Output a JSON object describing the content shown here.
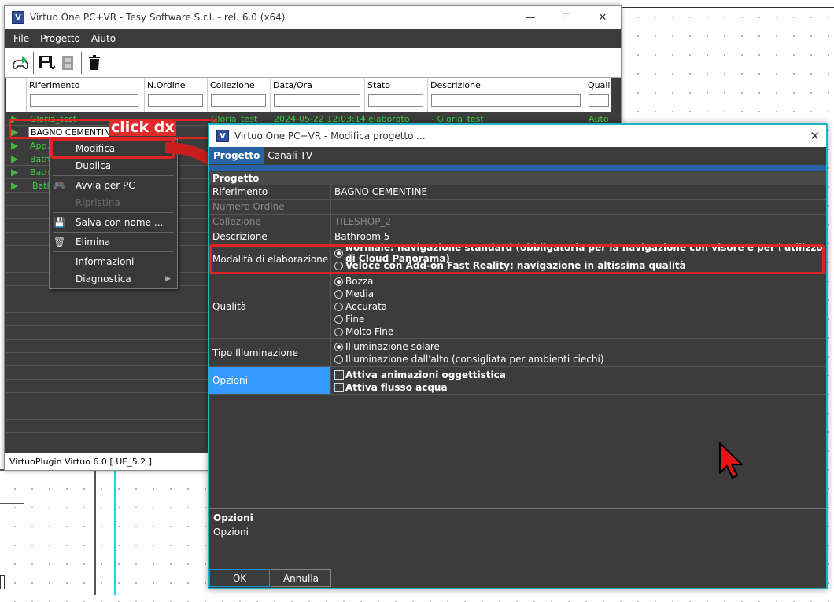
{
  "main_window": {
    "title": "Virtuo One PC+VR - Tesy Software S.r.l. - rel. 6.0  (x64)",
    "app_icon": "V",
    "controls": {
      "minimize": "—",
      "maximize": "☐",
      "close": "✕"
    },
    "menu": [
      "File",
      "Progetto",
      "Aiuto"
    ],
    "toolbar_icons": [
      "vr-gamepad-icon",
      "save-icon",
      "film-icon",
      "trash-icon"
    ],
    "columns": [
      "Riferimento",
      "N.Ordine",
      "Collezione",
      "Data/Ora",
      "Stato",
      "Descrizione",
      "Quali"
    ],
    "rows": [
      {
        "ref": "Gloria_test",
        "coll": "Gloria_test",
        "date": "2024-05-22 12:03:14",
        "stato": "elaborato",
        "desc": "- Gloria_test",
        "qual": "Auto"
      },
      {
        "ref": "BAGNO CEMENTINE",
        "coll": "",
        "date": "",
        "stato": "",
        "desc": "",
        "qual": ""
      },
      {
        "ref": "App..",
        "coll": "",
        "date": "",
        "stato": "",
        "desc": "",
        "qual": ""
      },
      {
        "ref": "Bathr",
        "coll": "",
        "date": "",
        "stato": "",
        "desc": "",
        "qual": ""
      },
      {
        "ref": "Bathr",
        "coll": "",
        "date": "",
        "stato": "",
        "desc": "",
        "qual": ""
      },
      {
        "ref": "Bath",
        "coll": "",
        "date": "",
        "stato": "",
        "desc": "",
        "qual": ""
      }
    ],
    "status": "VirtuoPlugin Virtuo 6.0  [ UE_5.2 ]"
  },
  "annotation": {
    "label": "click dx"
  },
  "context_menu": {
    "items": [
      {
        "label": "Modifica",
        "disabled": false
      },
      {
        "label": "Duplica",
        "disabled": false
      },
      {
        "label": "Avvia per PC",
        "disabled": false
      },
      {
        "label": "Ripristina",
        "disabled": true
      },
      {
        "label": "Salva con nome ...",
        "disabled": false
      },
      {
        "label": "Elimina",
        "disabled": false
      },
      {
        "label": "Informazioni",
        "disabled": false
      },
      {
        "label": "Diagnostica",
        "disabled": false
      }
    ]
  },
  "dialog": {
    "title": "Virtuo One PC+VR - Modifica progetto ...",
    "close": "✕",
    "tabs": [
      "Progetto",
      "Canali TV"
    ],
    "section": "Progetto",
    "props": [
      {
        "label": "Riferimento",
        "value": "BAGNO CEMENTINE"
      },
      {
        "label": "Numero Ordine",
        "value": ""
      },
      {
        "label": "Collezione",
        "value": "TILESHOP_2"
      },
      {
        "label": "Descrizione",
        "value": "Bathroom 5"
      }
    ],
    "modalita": {
      "label": "Modalità di elaborazione",
      "options": [
        "Normale: navigazione standard (obbligatoria per la navigazione con visore e per l'utilizzo di Cloud Panorama)",
        "Veloce con Add-on Fast Reality: navigazione in altissima qualità"
      ]
    },
    "qualita": {
      "label": "Qualità",
      "options": [
        "Bozza",
        "Media",
        "Accurata",
        "Fine",
        "Molto Fine"
      ]
    },
    "illuminazione": {
      "label": "Tipo Illuminazione",
      "options": [
        "Illuminazione solare",
        "Illuminazione dall'alto (consigliata per ambienti ciechi)"
      ]
    },
    "opzioni": {
      "label": "Opzioni",
      "options": [
        "Attiva animazioni oggettistica",
        "Attiva flusso acqua"
      ]
    },
    "description": {
      "title": "Opzioni",
      "text": "Opzioni"
    },
    "ok": "OK",
    "cancel": "Annulla"
  },
  "colors": {
    "accent": "#2764a6",
    "selected_row": "#3399ff",
    "highlight": "#e02424",
    "row_text": "#3dd23d"
  }
}
